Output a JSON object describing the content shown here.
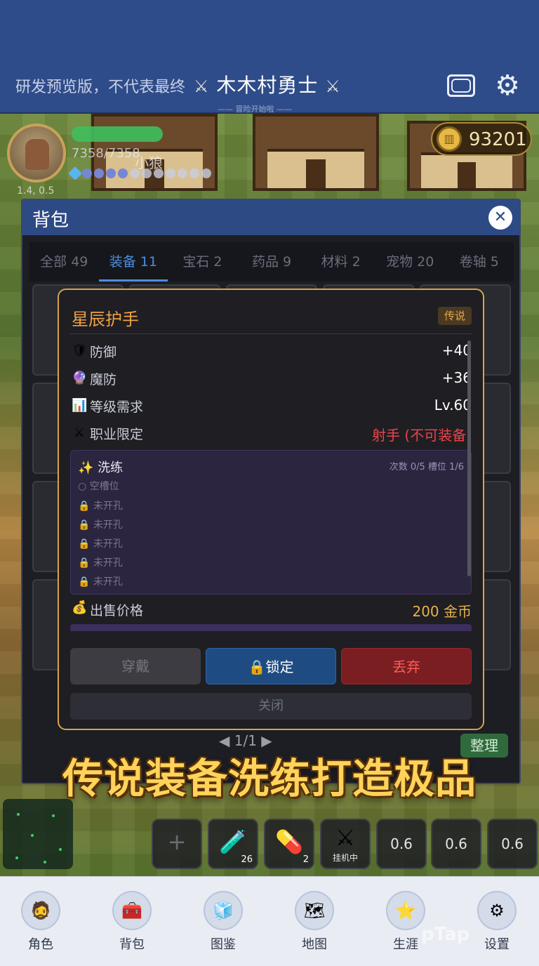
{
  "header": {
    "preview_notice": "研发预览版，不代表最终",
    "title": "木木村勇士",
    "subtitle": "—— 冒险开始啦 ——",
    "sword_glyph": "⚔"
  },
  "player": {
    "hp_text": "7358/7358",
    "pet_name": "小狼",
    "stat_text": "1.4, 0.5",
    "gold": "93201"
  },
  "bag": {
    "title": "背包",
    "close_glyph": "✕",
    "tabs": [
      {
        "label": "全部 49",
        "active": false
      },
      {
        "label": "装备 11",
        "active": true
      },
      {
        "label": "宝石 2",
        "active": false
      },
      {
        "label": "药品 9",
        "active": false
      },
      {
        "label": "材料 2",
        "active": false
      },
      {
        "label": "宠物 20",
        "active": false
      },
      {
        "label": "卷轴 5",
        "active": false
      }
    ],
    "pager": "1/1",
    "sort_label": "整理"
  },
  "item": {
    "name": "星辰护手",
    "rarity": "传说",
    "stats": [
      {
        "icon": "shield-icon",
        "glyph": "🛡",
        "label": "防御",
        "value": "+40",
        "warn": false
      },
      {
        "icon": "crystal-ball-icon",
        "glyph": "🔮",
        "label": "魔防",
        "value": "+36",
        "warn": false
      },
      {
        "icon": "chart-icon",
        "glyph": "📊",
        "label": "等级需求",
        "value": "Lv.60",
        "warn": false
      },
      {
        "icon": "crossed-swords-icon",
        "glyph": "⚔",
        "label": "职业限定",
        "value": "射手 (不可装备)",
        "warn": true
      }
    ],
    "refine": {
      "title": "✨ 洗练",
      "info": "次数 0/5  槽位 1/6",
      "empty_slot": "空槽位",
      "locked_slot": "未开孔",
      "locked_count": 5
    },
    "price_label": "出售价格",
    "price_value": "200 金币",
    "buttons": {
      "equip": "穿戴",
      "lock": "锁定",
      "drop": "丢弃",
      "close": "关闭"
    }
  },
  "promo_banner": "传说装备洗练打造极品",
  "hotbar": {
    "potion_count": "26",
    "pill_count": "2",
    "auto_label": "挂机中",
    "cooldowns": [
      "0.6",
      "0.6",
      "0.6"
    ]
  },
  "nav": [
    {
      "label": "角色",
      "icon": "character-icon",
      "glyph": "🧔"
    },
    {
      "label": "背包",
      "icon": "chest-icon",
      "glyph": "🧰"
    },
    {
      "label": "图鉴",
      "icon": "cube-icon",
      "glyph": "🧊"
    },
    {
      "label": "地图",
      "icon": "map-icon",
      "glyph": "🗺"
    },
    {
      "label": "生涯",
      "icon": "star-icon",
      "glyph": "⭐"
    },
    {
      "label": "设置",
      "icon": "gears-icon",
      "glyph": "⚙"
    }
  ],
  "watermark": "pTap"
}
